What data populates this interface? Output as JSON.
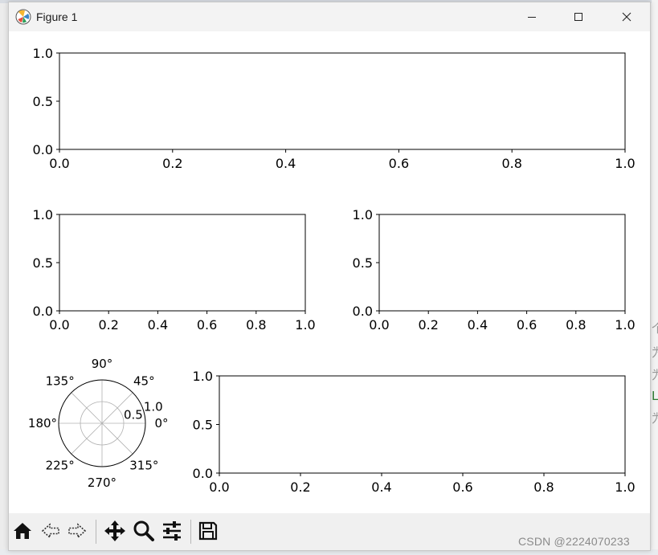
{
  "window": {
    "title": "Figure 1",
    "minimize_label": "Minimize",
    "maximize_label": "Maximize",
    "close_label": "Close"
  },
  "toolbar": {
    "tools": [
      {
        "name": "home",
        "icon": "home-icon"
      },
      {
        "name": "back",
        "icon": "back-arrow-icon"
      },
      {
        "name": "forward",
        "icon": "forward-arrow-icon"
      },
      {
        "name": "pan",
        "icon": "pan-move-icon"
      },
      {
        "name": "zoom",
        "icon": "zoom-magnifier-icon"
      },
      {
        "name": "configure-subplots",
        "icon": "sliders-icon"
      },
      {
        "name": "save",
        "icon": "floppy-disk-icon"
      }
    ]
  },
  "watermark": "CSDN @2224070233",
  "chart_data": [
    {
      "type": "line",
      "title": "",
      "xlabel": "",
      "ylabel": "",
      "xlim": [
        0.0,
        1.0
      ],
      "ylim": [
        0.0,
        1.0
      ],
      "xticks": [
        "0.0",
        "0.2",
        "0.4",
        "0.6",
        "0.8",
        "1.0"
      ],
      "yticks": [
        "0.0",
        "0.5",
        "1.0"
      ],
      "series": []
    },
    {
      "type": "line",
      "title": "",
      "xlabel": "",
      "ylabel": "",
      "xlim": [
        0.0,
        1.0
      ],
      "ylim": [
        0.0,
        1.0
      ],
      "xticks": [
        "0.0",
        "0.2",
        "0.4",
        "0.6",
        "0.8",
        "1.0"
      ],
      "yticks": [
        "0.0",
        "0.5",
        "1.0"
      ],
      "series": []
    },
    {
      "type": "line",
      "title": "",
      "xlabel": "",
      "ylabel": "",
      "xlim": [
        0.0,
        1.0
      ],
      "ylim": [
        0.0,
        1.0
      ],
      "xticks": [
        "0.0",
        "0.2",
        "0.4",
        "0.6",
        "0.8",
        "1.0"
      ],
      "yticks": [
        "0.0",
        "0.5",
        "1.0"
      ],
      "series": []
    },
    {
      "type": "polar",
      "title": "",
      "theta_ticks": [
        "0°",
        "45°",
        "90°",
        "135°",
        "180°",
        "225°",
        "270°",
        "315°"
      ],
      "r_ticks": [
        "0.5",
        "1.0"
      ],
      "rlim": [
        0.0,
        1.0
      ],
      "series": []
    },
    {
      "type": "line",
      "title": "",
      "xlabel": "",
      "ylabel": "",
      "xlim": [
        0.0,
        1.0
      ],
      "ylim": [
        0.0,
        1.0
      ],
      "xticks": [
        "0.0",
        "0.2",
        "0.4",
        "0.6",
        "0.8",
        "1.0"
      ],
      "yticks": [
        "0.0",
        "0.5",
        "1.0"
      ],
      "series": []
    }
  ]
}
